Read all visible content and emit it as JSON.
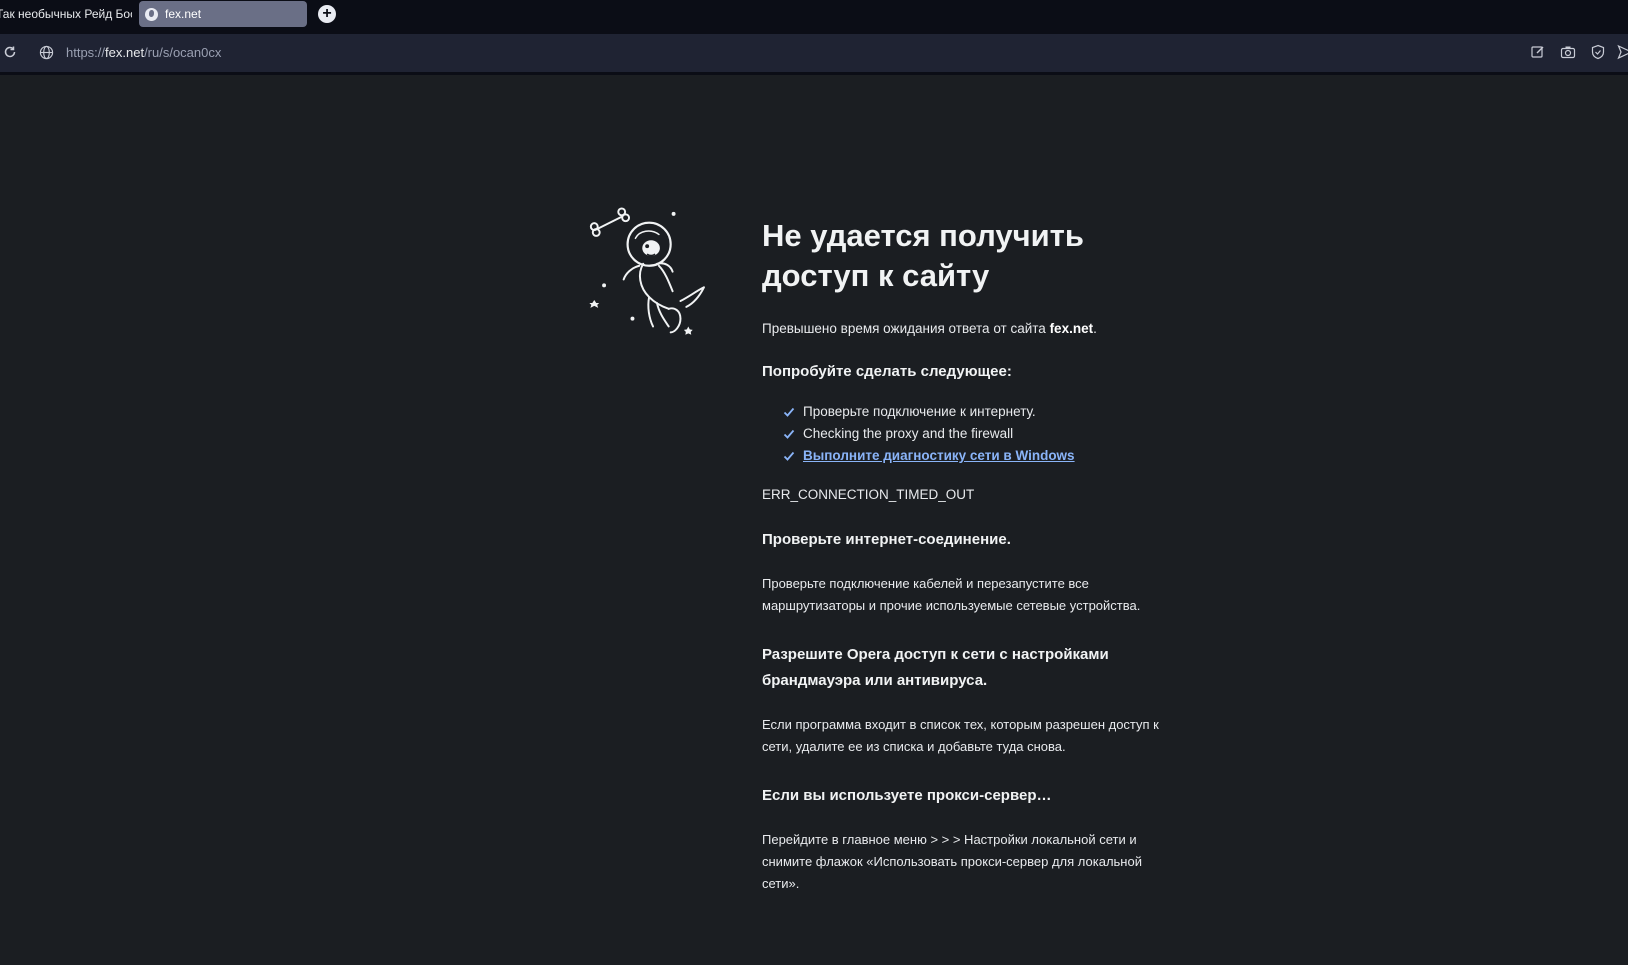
{
  "browser": {
    "tabs": [
      {
        "label": "Так необычных Рейд Бос",
        "active": false
      },
      {
        "label": "fex.net",
        "active": true
      }
    ],
    "new_tab_symbol": "+",
    "url_prefix": "https://",
    "url_host": "fex.net",
    "url_path": "/ru/s/ocan0cx",
    "icons": [
      "reload-icon",
      "site-info-icon",
      "edit-icon",
      "camera-icon",
      "shield-icon",
      "send-icon"
    ]
  },
  "error": {
    "title": "Не удается получить доступ к сайту",
    "summary_text": "Превышено время ожидания ответа от сайта ",
    "summary_host": "fex.net",
    "summary_end": ".",
    "suggestions_heading": "Попробуйте сделать следующее:",
    "suggestions": [
      "Проверьте подключение к интернету.",
      "Checking the proxy and the firewall",
      "Выполните диагностику сети в Windows"
    ],
    "code": "ERR_CONNECTION_TIMED_OUT",
    "sections": [
      {
        "heading": "Проверьте интернет-соединение.",
        "body": "Проверьте подключение кабелей и перезапустите все маршрутизаторы и прочие используемые сетевые устройства."
      },
      {
        "heading": "Разрешите Opera доступ к сети с настройками брандмауэра или антивируса.",
        "body": "Если программа входит в список тех, которым разрешен доступ к сети, удалите ее из списка и добавьте туда снова."
      },
      {
        "heading": "Если вы используете прокси-сервер…",
        "body": "Перейдите в главное меню > > > Настройки локальной сети и снимите флажок «Использовать прокси-сервер для локальной сети»."
      }
    ]
  },
  "colors": {
    "background": "#1b1e22",
    "link": "#8ab4f8",
    "tab_active": "#6a6f86",
    "toolbar": "#1f2333"
  }
}
